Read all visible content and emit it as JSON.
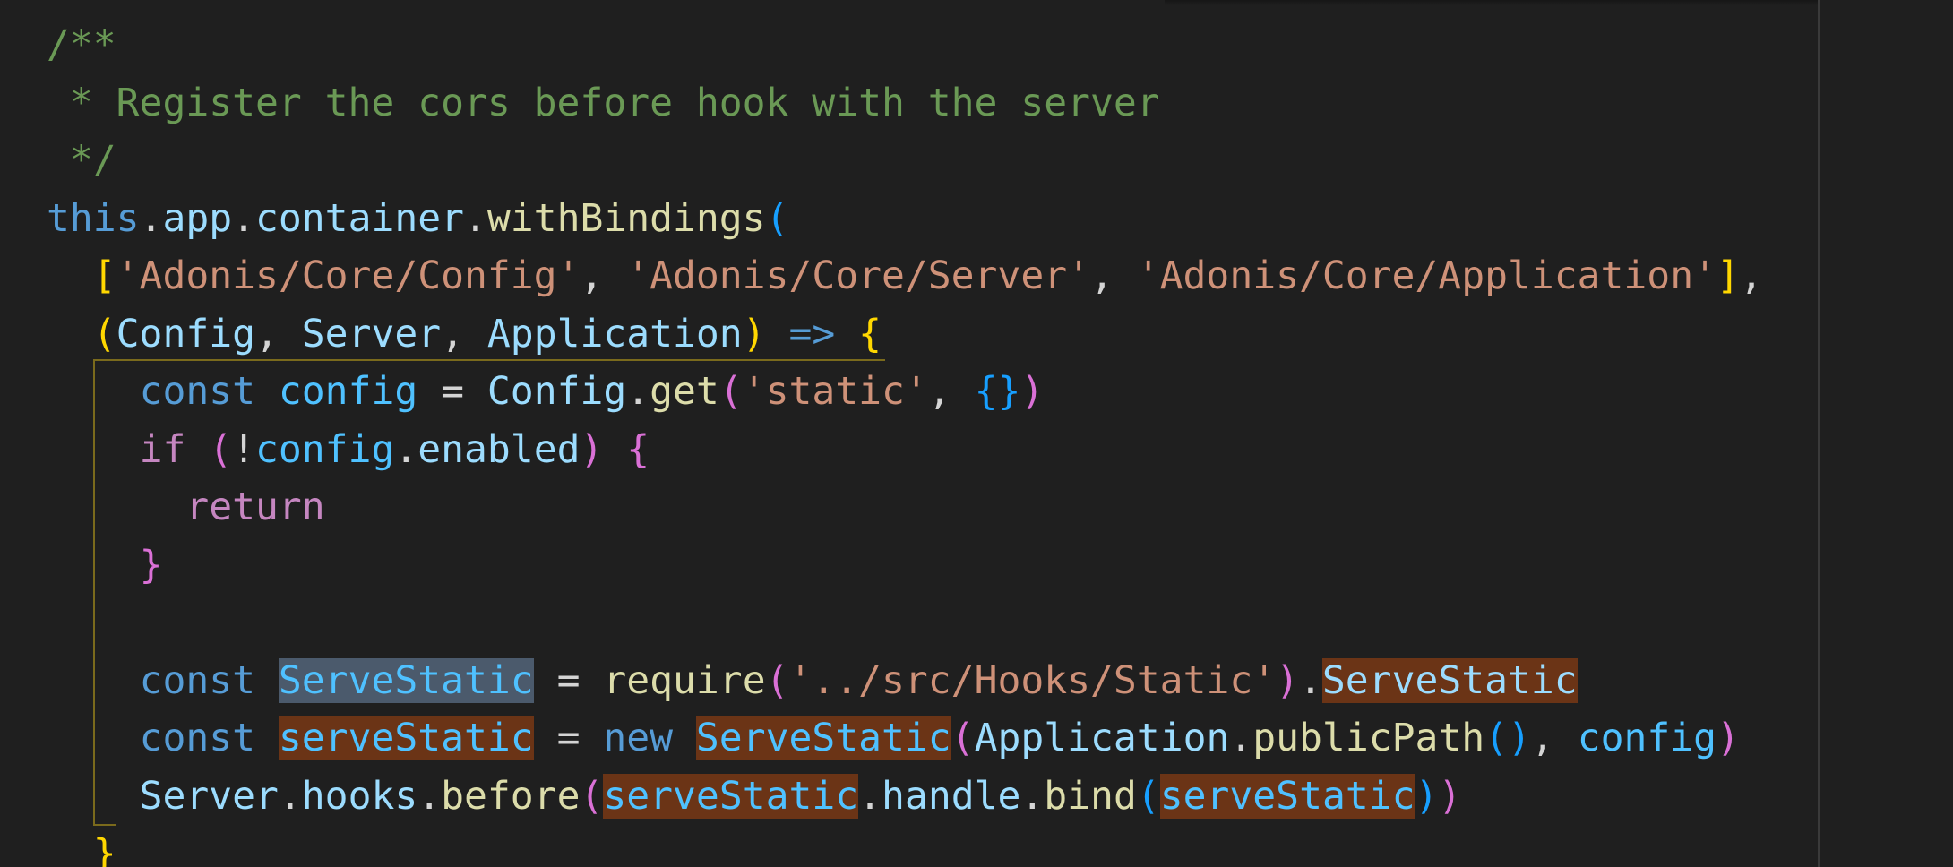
{
  "editor": {
    "language": "javascript",
    "lines": [
      {
        "tokens": [
          {
            "t": "/**",
            "k": "comment"
          }
        ]
      },
      {
        "tokens": [
          {
            "t": " * Register the cors before hook with the server",
            "k": "comment"
          }
        ]
      },
      {
        "tokens": [
          {
            "t": " */",
            "k": "comment"
          }
        ]
      },
      {
        "tokens": [
          {
            "t": "this",
            "k": "this"
          },
          {
            "t": ".",
            "k": "plain"
          },
          {
            "t": "app",
            "k": "prop"
          },
          {
            "t": ".",
            "k": "plain"
          },
          {
            "t": "container",
            "k": "prop"
          },
          {
            "t": ".",
            "k": "plain"
          },
          {
            "t": "withBindings",
            "k": "func"
          },
          {
            "t": "(",
            "k": "brace3"
          }
        ]
      },
      {
        "tokens": [
          {
            "t": "  ",
            "k": "plain"
          },
          {
            "t": "[",
            "k": "brace1"
          },
          {
            "t": "'Adonis/Core/Config'",
            "k": "string"
          },
          {
            "t": ", ",
            "k": "plain"
          },
          {
            "t": "'Adonis/Core/Server'",
            "k": "string"
          },
          {
            "t": ", ",
            "k": "plain"
          },
          {
            "t": "'Adonis/Core/Application'",
            "k": "string"
          },
          {
            "t": "]",
            "k": "brace1"
          },
          {
            "t": ",",
            "k": "plain"
          }
        ]
      },
      {
        "tokens": [
          {
            "t": "  ",
            "k": "plain"
          },
          {
            "t": "(",
            "k": "brace1"
          },
          {
            "t": "Config",
            "k": "prop"
          },
          {
            "t": ", ",
            "k": "plain"
          },
          {
            "t": "Server",
            "k": "prop"
          },
          {
            "t": ", ",
            "k": "plain"
          },
          {
            "t": "Application",
            "k": "prop"
          },
          {
            "t": ")",
            "k": "brace1"
          },
          {
            "t": " ",
            "k": "plain"
          },
          {
            "t": "=>",
            "k": "keyword"
          },
          {
            "t": " ",
            "k": "plain"
          },
          {
            "t": "{",
            "k": "brace1"
          }
        ]
      },
      {
        "tokens": [
          {
            "t": "    ",
            "k": "plain"
          },
          {
            "t": "const",
            "k": "keyword"
          },
          {
            "t": " ",
            "k": "plain"
          },
          {
            "t": "config",
            "k": "var"
          },
          {
            "t": " = ",
            "k": "plain"
          },
          {
            "t": "Config",
            "k": "prop"
          },
          {
            "t": ".",
            "k": "plain"
          },
          {
            "t": "get",
            "k": "func"
          },
          {
            "t": "(",
            "k": "brace2"
          },
          {
            "t": "'static'",
            "k": "string"
          },
          {
            "t": ", ",
            "k": "plain"
          },
          {
            "t": "{}",
            "k": "brace3"
          },
          {
            "t": ")",
            "k": "brace2"
          }
        ]
      },
      {
        "tokens": [
          {
            "t": "    ",
            "k": "plain"
          },
          {
            "t": "if",
            "k": "control"
          },
          {
            "t": " ",
            "k": "plain"
          },
          {
            "t": "(",
            "k": "brace2"
          },
          {
            "t": "!",
            "k": "plain"
          },
          {
            "t": "config",
            "k": "var"
          },
          {
            "t": ".",
            "k": "plain"
          },
          {
            "t": "enabled",
            "k": "prop"
          },
          {
            "t": ")",
            "k": "brace2"
          },
          {
            "t": " ",
            "k": "plain"
          },
          {
            "t": "{",
            "k": "brace2"
          }
        ]
      },
      {
        "tokens": [
          {
            "t": "      ",
            "k": "plain"
          },
          {
            "t": "return",
            "k": "control"
          }
        ]
      },
      {
        "tokens": [
          {
            "t": "    ",
            "k": "plain"
          },
          {
            "t": "}",
            "k": "brace2"
          }
        ]
      },
      {
        "tokens": []
      },
      {
        "tokens": [
          {
            "t": "    ",
            "k": "plain"
          },
          {
            "t": "const",
            "k": "keyword"
          },
          {
            "t": " ",
            "k": "plain"
          },
          {
            "t": "ServeStatic",
            "k": "var",
            "h": "sel"
          },
          {
            "t": " = ",
            "k": "plain"
          },
          {
            "t": "require",
            "k": "func"
          },
          {
            "t": "(",
            "k": "brace2"
          },
          {
            "t": "'../src/Hooks/Static'",
            "k": "string"
          },
          {
            "t": ")",
            "k": "brace2"
          },
          {
            "t": ".",
            "k": "plain"
          },
          {
            "t": "ServeStatic",
            "k": "prop",
            "h": "occ"
          }
        ]
      },
      {
        "tokens": [
          {
            "t": "    ",
            "k": "plain"
          },
          {
            "t": "const",
            "k": "keyword"
          },
          {
            "t": " ",
            "k": "plain"
          },
          {
            "t": "serveStatic",
            "k": "var",
            "h": "occ"
          },
          {
            "t": " = ",
            "k": "plain"
          },
          {
            "t": "new",
            "k": "keyword"
          },
          {
            "t": " ",
            "k": "plain"
          },
          {
            "t": "ServeStatic",
            "k": "var",
            "h": "occ"
          },
          {
            "t": "(",
            "k": "brace2"
          },
          {
            "t": "Application",
            "k": "prop"
          },
          {
            "t": ".",
            "k": "plain"
          },
          {
            "t": "publicPath",
            "k": "func"
          },
          {
            "t": "()",
            "k": "brace3"
          },
          {
            "t": ", ",
            "k": "plain"
          },
          {
            "t": "config",
            "k": "var"
          },
          {
            "t": ")",
            "k": "brace2"
          }
        ]
      },
      {
        "tokens": [
          {
            "t": "    ",
            "k": "plain"
          },
          {
            "t": "Server",
            "k": "prop"
          },
          {
            "t": ".",
            "k": "plain"
          },
          {
            "t": "hooks",
            "k": "prop"
          },
          {
            "t": ".",
            "k": "plain"
          },
          {
            "t": "before",
            "k": "func"
          },
          {
            "t": "(",
            "k": "brace2"
          },
          {
            "t": "serveStatic",
            "k": "var",
            "h": "occ"
          },
          {
            "t": ".",
            "k": "plain"
          },
          {
            "t": "handle",
            "k": "prop"
          },
          {
            "t": ".",
            "k": "plain"
          },
          {
            "t": "bind",
            "k": "func"
          },
          {
            "t": "(",
            "k": "brace3"
          },
          {
            "t": "serveStatic",
            "k": "var",
            "h": "occ"
          },
          {
            "t": ")",
            "k": "brace3"
          },
          {
            "t": ")",
            "k": "brace2"
          }
        ]
      },
      {
        "tokens": [
          {
            "t": "  ",
            "k": "plain"
          },
          {
            "t": "}",
            "k": "brace1"
          }
        ]
      }
    ]
  }
}
